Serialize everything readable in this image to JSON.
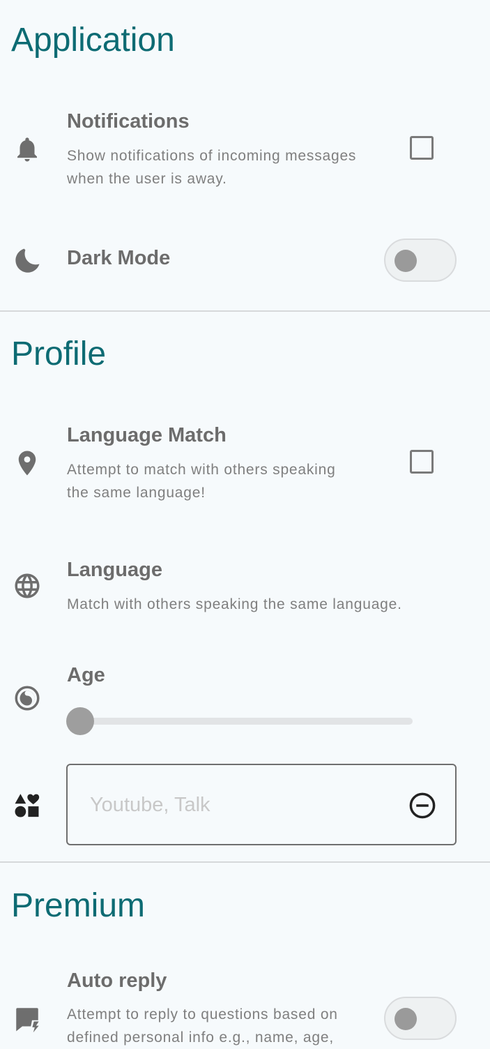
{
  "sections": {
    "application": {
      "title": "Application",
      "notifications": {
        "icon": "bell-icon",
        "title": "Notifications",
        "description_line1": "Show notifications of incoming messages",
        "description_line2": "when the user is away.",
        "checked": false
      },
      "dark_mode": {
        "icon": "moon-icon",
        "title": "Dark Mode",
        "enabled": false
      }
    },
    "profile": {
      "title": "Profile",
      "language_match": {
        "icon": "location-pin-icon",
        "title": "Language Match",
        "description_line1": "Attempt to match with others speaking",
        "description_line2": "the same language!",
        "checked": false
      },
      "language": {
        "icon": "globe-icon",
        "title": "Language",
        "description": "Match with others speaking the same language."
      },
      "age": {
        "icon": "clock-icon",
        "title": "Age",
        "slider_value": 0
      },
      "interests": {
        "icon": "shapes-icon",
        "placeholder": "Youtube, Talk",
        "value": "",
        "clear_icon": "remove-circle-icon"
      }
    },
    "premium": {
      "title": "Premium",
      "auto_reply": {
        "icon": "auto-reply-icon",
        "title": "Auto reply",
        "description_line1": "Attempt to reply to questions based on",
        "description_line2": "defined personal info e.g., name, age,",
        "enabled": false
      }
    }
  },
  "colors": {
    "background": "#f6fafc",
    "section_title": "#0d6b73",
    "text": "#6c6c6c",
    "divider": "#d6d8da"
  }
}
